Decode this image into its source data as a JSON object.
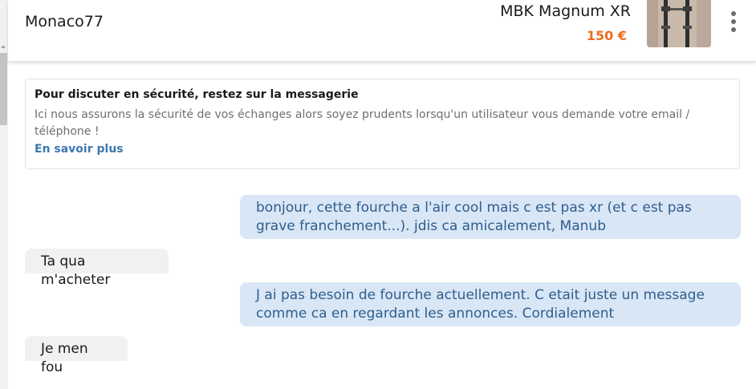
{
  "header": {
    "username": "Monaco77",
    "listing_title": "MBK Magnum XR",
    "listing_price": "150 €",
    "menu_icon": "more-vertical-icon",
    "thumbnail_icon": "bike-fork-photo"
  },
  "notice": {
    "title": "Pour discuter en sécurité, restez sur la messagerie",
    "body": "Ici nous assurons la sécurité de vos échanges alors soyez prudents lorsqu'un utilisateur vous demande votre email / téléphone !",
    "link": "En savoir plus"
  },
  "messages": [
    {
      "direction": "out",
      "text": "bonjour, cette fourche a l'air cool mais c est pas xr (et c est pas grave franchement...). jdis ca amicalement, Manub"
    },
    {
      "direction": "in",
      "text": "Ta qua m'acheter"
    },
    {
      "direction": "out",
      "text": "J ai pas besoin de fourche actuellement. C etait juste un message comme ca en regardant les annonces. Cordialement"
    },
    {
      "direction": "in",
      "text": "Je men fou"
    }
  ],
  "colors": {
    "accent_price": "#ec6d1f",
    "link": "#3d78b1",
    "outgoing_bubble": "#d9e6f6",
    "incoming_bubble": "#f1f1f1"
  }
}
